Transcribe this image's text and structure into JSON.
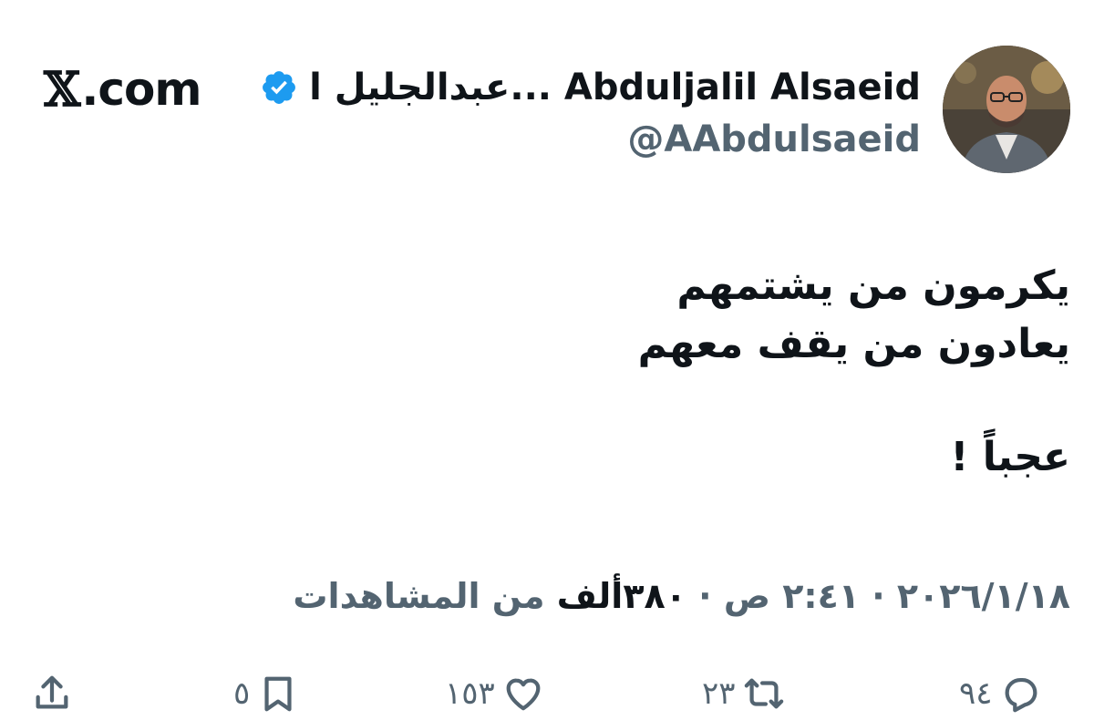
{
  "site": {
    "logo_mark": "𝕏",
    "logo_text": ".com"
  },
  "author": {
    "display_name": "عبدالجليل ا... Abduljalil Alsaeid",
    "handle": "@AAbdulsaeid",
    "verified_icon": "verified-badge-icon",
    "verified_color": "#1d9bf0",
    "avatar_icon": "profile-photo"
  },
  "tweet": {
    "line1": "يكرمون من يشتمهم",
    "line2": "يعادون من يقف معهم",
    "line3": "عجباً !"
  },
  "meta": {
    "date": "٢٠٢٦/١/١٨",
    "separator": " · ",
    "time": "٢:٤١ ص",
    "views_count": "٣٨٠ألف",
    "views_label": " من المشاهدات"
  },
  "actions": {
    "replies": "٩٤",
    "reposts": "٢٣",
    "likes": "١٥٣",
    "bookmarks": "٥"
  },
  "colors": {
    "text": "#0f1419",
    "muted": "#536471",
    "accent": "#1d9bf0"
  }
}
